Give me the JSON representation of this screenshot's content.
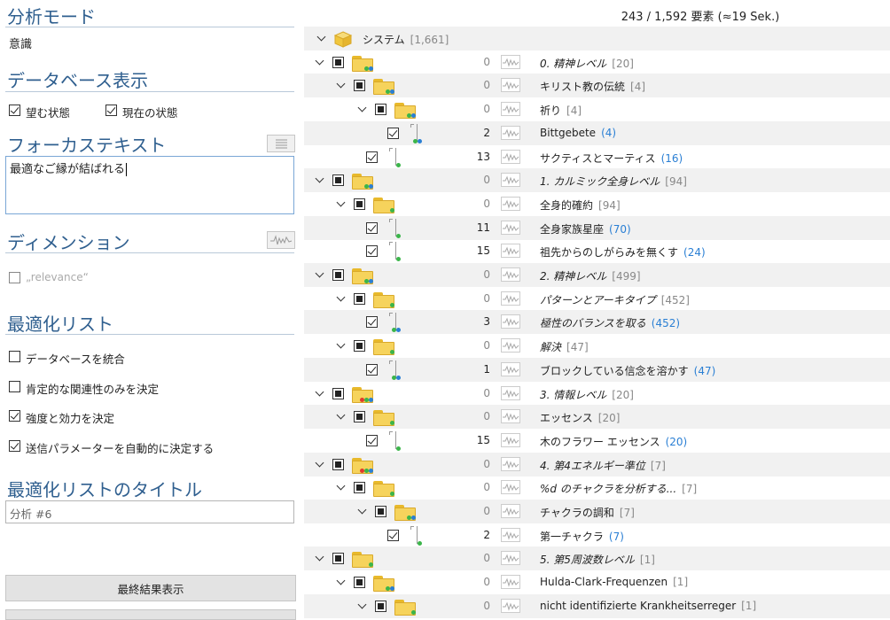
{
  "left": {
    "analysis_mode": {
      "title": "分析モード",
      "value": "意識"
    },
    "db_display": {
      "title": "データベース表示",
      "opt1": "望む状態",
      "opt2": "現在の状態",
      "opt1_checked": true,
      "opt2_checked": true
    },
    "focus_text": {
      "title": "フォーカステキスト",
      "value": "最適なご縁が結ばれる"
    },
    "dimension": {
      "title": "ディメンション",
      "relevance": "„relevance“"
    },
    "optimization": {
      "title": "最適化リスト",
      "items": [
        {
          "label": "データベースを統合",
          "checked": false
        },
        {
          "label": "肯定的な関連性のみを決定",
          "checked": false
        },
        {
          "label": "強度と効力を決定",
          "checked": true
        },
        {
          "label": "送信パラメーターを自動的に決定する",
          "checked": true
        }
      ]
    },
    "list_title": {
      "title": "最適化リストのタイトル",
      "value": "分析 #6"
    },
    "final_button": "最終結果表示"
  },
  "status": "243 / 1,592 要素 (≈19 Sek.)",
  "colors": {
    "accent": "#2f5f8f",
    "folder": "#f6d35c",
    "count_blue": "#2a7fd4",
    "dot_green": "#3bb54a",
    "dot_blue": "#2a7fd4",
    "dot_red": "#e03a2f"
  },
  "tree": {
    "root": {
      "name": "システム",
      "count": "[1,661]"
    },
    "rows": [
      {
        "name": "0. 精神レベル",
        "count": "[20]",
        "num": "0",
        "italic": true
      },
      {
        "name": "キリスト教の伝統",
        "count": "[4]",
        "num": "0",
        "italic": false
      },
      {
        "name": "祈り",
        "count": "[4]",
        "num": "0",
        "italic": false
      },
      {
        "name": "Bittgebete",
        "count": "(4)",
        "num": "2",
        "italic": false
      },
      {
        "name": "サクティスとマーティス",
        "count": "(16)",
        "num": "13",
        "italic": false
      },
      {
        "name": "1. カルミック全身レベル",
        "count": "[94]",
        "num": "0",
        "italic": true
      },
      {
        "name": "全身的確約",
        "count": "[94]",
        "num": "0",
        "italic": false
      },
      {
        "name": "全身家族星座",
        "count": "(70)",
        "num": "11",
        "italic": false
      },
      {
        "name": "祖先からのしがらみを無くす",
        "count": "(24)",
        "num": "15",
        "italic": false
      },
      {
        "name": "2. 精神レベル",
        "count": "[499]",
        "num": "0",
        "italic": true
      },
      {
        "name": "パターンとアーキタイプ",
        "count": "[452]",
        "num": "0",
        "italic": true
      },
      {
        "name": "極性のバランスを取る",
        "count": "(452)",
        "num": "3",
        "italic": true
      },
      {
        "name": "解決",
        "count": "[47]",
        "num": "0",
        "italic": true
      },
      {
        "name": "ブロックしている信念を溶かす",
        "count": "(47)",
        "num": "1",
        "italic": false
      },
      {
        "name": "3. 情報レベル",
        "count": "[20]",
        "num": "0",
        "italic": true
      },
      {
        "name": "エッセンス",
        "count": "[20]",
        "num": "0",
        "italic": false
      },
      {
        "name": "木のフラワー エッセンス",
        "count": "(20)",
        "num": "15",
        "italic": false
      },
      {
        "name": "4. 第4エネルギー準位",
        "count": "[7]",
        "num": "0",
        "italic": true
      },
      {
        "name": "%d のチャクラを分析する...",
        "count": "[7]",
        "num": "0",
        "italic": true
      },
      {
        "name": "チャクラの調和",
        "count": "[7]",
        "num": "0",
        "italic": false
      },
      {
        "name": "第一チャクラ",
        "count": "(7)",
        "num": "2",
        "italic": false
      },
      {
        "name": "5. 第5周波数レベル",
        "count": "[1]",
        "num": "0",
        "italic": true
      },
      {
        "name": "Hulda-Clark-Frequenzen",
        "count": "[1]",
        "num": "0",
        "italic": false
      },
      {
        "name": "nicht identifizierte Krankheitserreger",
        "count": "[1]",
        "num": "0",
        "italic": false
      }
    ]
  }
}
